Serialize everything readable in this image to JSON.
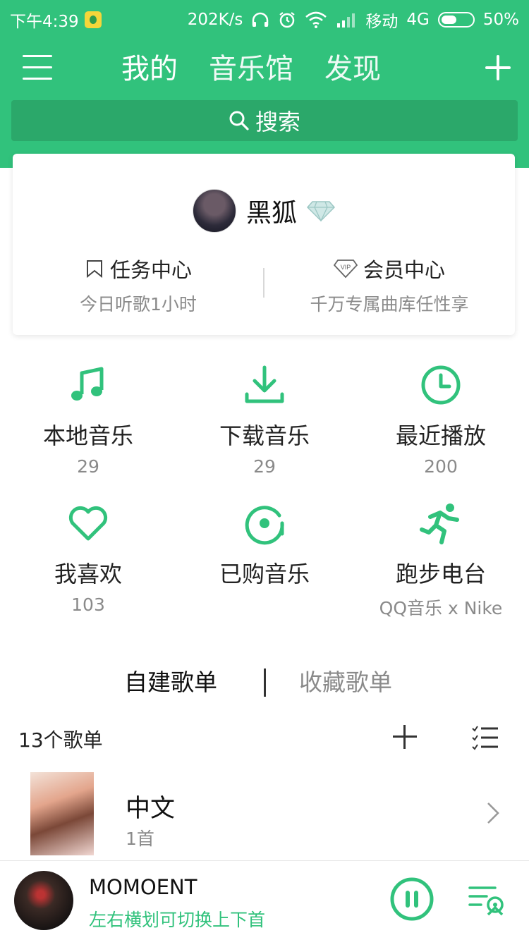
{
  "status_bar": {
    "time": "下午4:39",
    "net_speed": "202K/s",
    "carrier": "移动",
    "network": "4G",
    "battery": "50%",
    "battery_level": 0.5
  },
  "nav": {
    "tabs": [
      {
        "label": "我的"
      },
      {
        "label": "音乐馆"
      },
      {
        "label": "发现"
      }
    ]
  },
  "search": {
    "placeholder": "搜索"
  },
  "profile": {
    "name": "黑狐",
    "tasks": {
      "title": "任务中心",
      "sub": "今日听歌1小时"
    },
    "vip": {
      "title": "会员中心",
      "sub": "千万专属曲库任性享",
      "badge": "VIP"
    }
  },
  "features": [
    {
      "label": "本地音乐",
      "count": "29",
      "icon": "music-note-icon"
    },
    {
      "label": "下载音乐",
      "count": "29",
      "icon": "download-icon"
    },
    {
      "label": "最近播放",
      "count": "200",
      "icon": "clock-icon"
    },
    {
      "label": "我喜欢",
      "count": "103",
      "icon": "heart-icon"
    },
    {
      "label": "已购音乐",
      "count": "",
      "icon": "purchased-disc-icon"
    },
    {
      "label": "跑步电台",
      "count": "QQ音乐 x Nike",
      "icon": "running-icon"
    }
  ],
  "playlist_tabs": {
    "created": "自建歌单",
    "favorited": "收藏歌单"
  },
  "playlists": {
    "count_label": "13个歌单",
    "items": [
      {
        "title": "中文",
        "sub": "1首"
      }
    ]
  },
  "player": {
    "title": "MOMOENT",
    "hint": "左右横划可切换上下首"
  },
  "colors": {
    "accent": "#31c27c",
    "search_bg": "#2ba86a"
  }
}
